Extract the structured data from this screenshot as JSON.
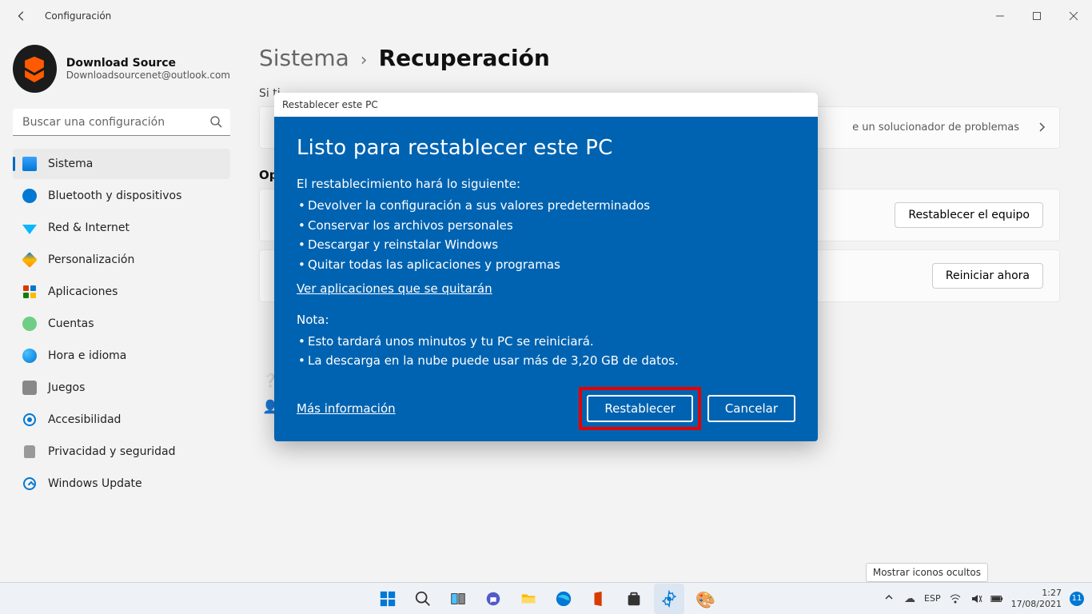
{
  "titlebar": {
    "app_title": "Configuración"
  },
  "profile": {
    "name": "Download Source",
    "email": "Downloadsourcenet@outlook.com"
  },
  "search": {
    "placeholder": "Buscar una configuración"
  },
  "nav": {
    "items": [
      {
        "label": "Sistema",
        "active": true,
        "icon": "sys"
      },
      {
        "label": "Bluetooth y dispositivos",
        "icon": "bt"
      },
      {
        "label": "Red & Internet",
        "icon": "net"
      },
      {
        "label": "Personalización",
        "icon": "pers"
      },
      {
        "label": "Aplicaciones",
        "icon": "apps"
      },
      {
        "label": "Cuentas",
        "icon": "acc"
      },
      {
        "label": "Hora e idioma",
        "icon": "time"
      },
      {
        "label": "Juegos",
        "icon": "games"
      },
      {
        "label": "Accesibilidad",
        "icon": "access"
      },
      {
        "label": "Privacidad y seguridad",
        "icon": "priv"
      },
      {
        "label": "Windows Update",
        "icon": "upd"
      }
    ]
  },
  "breadcrumb": {
    "parent": "Sistema",
    "sep": "›",
    "current": "Recuperación"
  },
  "content": {
    "intro_partial": "Si ti",
    "troubleshoot_desc": "e un solucionador de problemas",
    "section_header_partial": "Op",
    "reset_button": "Restablecer el equipo",
    "restart_button": "Reiniciar ahora"
  },
  "dialog": {
    "header": "Restablecer este PC",
    "title": "Listo para restablecer este PC",
    "intro": "El restablecimiento hará lo siguiente:",
    "bullets": [
      "Devolver la configuración a sus valores predeterminados",
      "Conservar los archivos personales",
      "Descargar y reinstalar Windows",
      "Quitar todas las aplicaciones y programas"
    ],
    "apps_link": "Ver aplicaciones que se quitarán",
    "note_label": "Nota:",
    "note_bullets": [
      "Esto tardará unos minutos y tu PC se reiniciará.",
      "La descarga en la nube puede usar más de 3,20 GB de datos."
    ],
    "more_info": "Más información",
    "reset_btn": "Restablecer",
    "cancel_btn": "Cancelar"
  },
  "taskbar": {
    "tooltip": "Mostrar iconos ocultos",
    "lang": "ESP",
    "time": "1:27",
    "date": "17/08/2021",
    "notif_count": "11"
  }
}
